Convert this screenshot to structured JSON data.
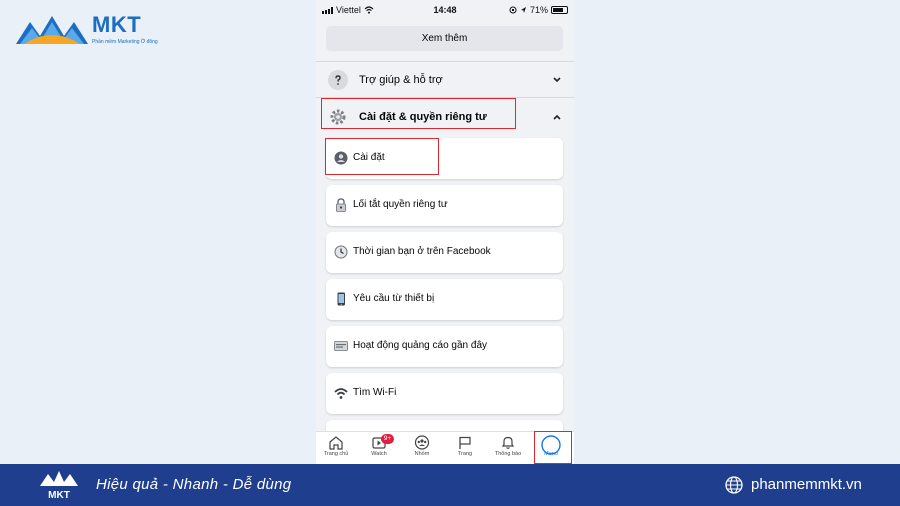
{
  "brand": {
    "name": "MKT",
    "tagline": "Phần mềm Marketing Ở đông",
    "colors": {
      "blue": "#1b6ec2",
      "orange": "#f5a623",
      "footer": "#1f3f8e",
      "highlight": "#e0262e"
    }
  },
  "status_bar": {
    "carrier": "Viettel",
    "time": "14:48",
    "battery": "71%"
  },
  "menu": {
    "see_more": "Xem thêm",
    "help_section": {
      "label": "Trợ giúp & hỗ trợ",
      "icon": "question-icon",
      "state": "collapsed"
    },
    "settings_section": {
      "label": "Cài đặt & quyền riêng tư",
      "icon": "gear-icon",
      "state": "expanded"
    },
    "items": [
      {
        "label": "Cài đặt",
        "icon": "profile-settings-icon"
      },
      {
        "label": "Lối tắt quyền riêng tư",
        "icon": "lock-icon"
      },
      {
        "label": "Thời gian bạn ở trên Facebook",
        "icon": "clock-icon"
      },
      {
        "label": "Yêu cầu từ thiết bị",
        "icon": "phone-icon"
      },
      {
        "label": "Hoạt động quảng cáo gần đây",
        "icon": "ad-icon"
      },
      {
        "label": "Tìm Wi-Fi",
        "icon": "wifi-icon"
      }
    ]
  },
  "tab_bar": {
    "tabs": [
      {
        "label": "Trang chủ",
        "icon": "home-icon"
      },
      {
        "label": "Watch",
        "icon": "watch-icon",
        "badge": "9+"
      },
      {
        "label": "Nhóm",
        "icon": "groups-icon"
      },
      {
        "label": "Trang",
        "icon": "flag-icon"
      },
      {
        "label": "Thông báo",
        "icon": "bell-icon"
      },
      {
        "label": "Menu",
        "icon": "menu-avatar-icon",
        "active": true
      }
    ]
  },
  "footer": {
    "slogan": "Hiệu quả - Nhanh - Dễ dùng",
    "website": "phanmemmkt.vn"
  }
}
